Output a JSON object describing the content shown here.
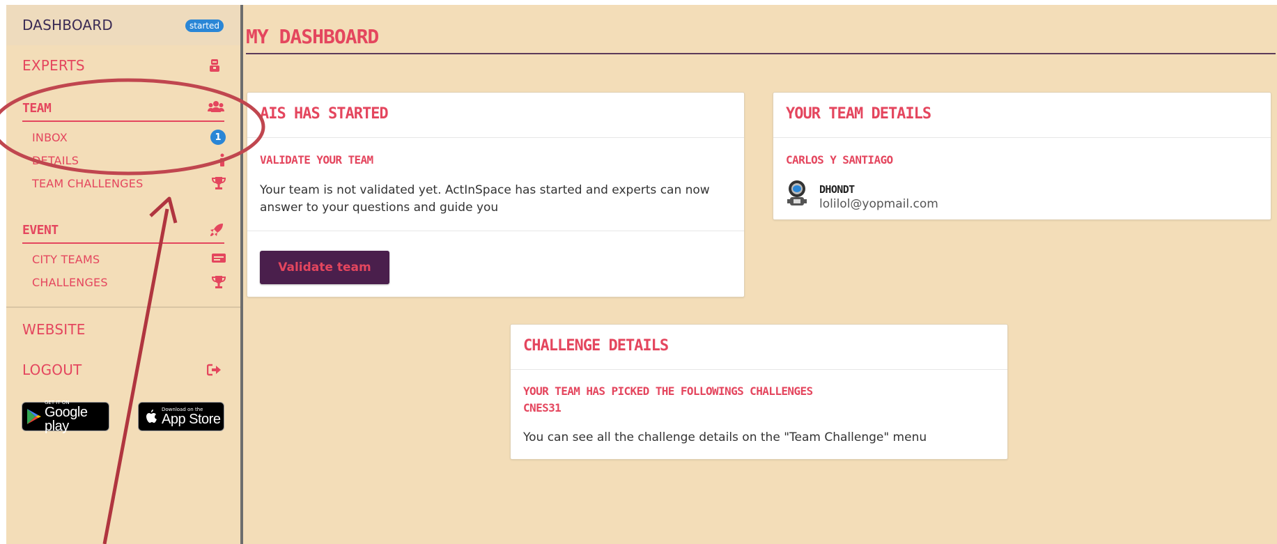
{
  "sidebar": {
    "dashboard": {
      "label": "DASHBOARD",
      "badge": "started",
      "icon": "started-badge"
    },
    "experts": {
      "label": "EXPERTS",
      "icon": "expert-icon"
    },
    "team": {
      "label": "TEAM",
      "icon": "users-icon",
      "items": [
        {
          "label": "INBOX",
          "badge": "1"
        },
        {
          "label": "DETAILS",
          "icon": "info-icon"
        },
        {
          "label": "TEAM CHALLENGES",
          "icon": "trophy-icon"
        }
      ]
    },
    "event": {
      "label": "EVENT",
      "icon": "rocket-icon",
      "items": [
        {
          "label": "CITY TEAMS",
          "icon": "id-card-icon"
        },
        {
          "label": "CHALLENGES",
          "icon": "trophy-icon"
        }
      ]
    },
    "website": {
      "label": "WEBSITE"
    },
    "logout": {
      "label": "LOGOUT",
      "icon": "sign-out-icon"
    },
    "stores": {
      "google": {
        "small": "GET IT ON",
        "big": "Google play"
      },
      "apple": {
        "small": "Download on the",
        "big": "App Store"
      }
    }
  },
  "main": {
    "title": "MY DASHBOARD",
    "started_card": {
      "title": "AIS HAS STARTED",
      "subtitle": "VALIDATE YOUR TEAM",
      "text": "Your team is not validated yet. ActInSpace has started and experts can now answer to your questions and guide you",
      "button": "Validate team"
    },
    "team_card": {
      "title": "YOUR TEAM DETAILS",
      "team_name": "CARLOS Y SANTIAGO",
      "member_name": "DHONDT",
      "member_email": "lolilol@yopmail.com"
    },
    "challenge_card": {
      "title": "CHALLENGE DETAILS",
      "subtitle": "YOUR TEAM HAS PICKED THE FOLLOWINGS CHALLENGES",
      "challenge": "CNES31",
      "text": "You can see all the challenge details on the \"Team Challenge\" menu"
    }
  },
  "colors": {
    "background": "#f3ddb8",
    "accent": "#e4465e",
    "dark_purple": "#4a1f4c",
    "badge_blue": "#2a86d6",
    "annotation": "#c0464f"
  }
}
